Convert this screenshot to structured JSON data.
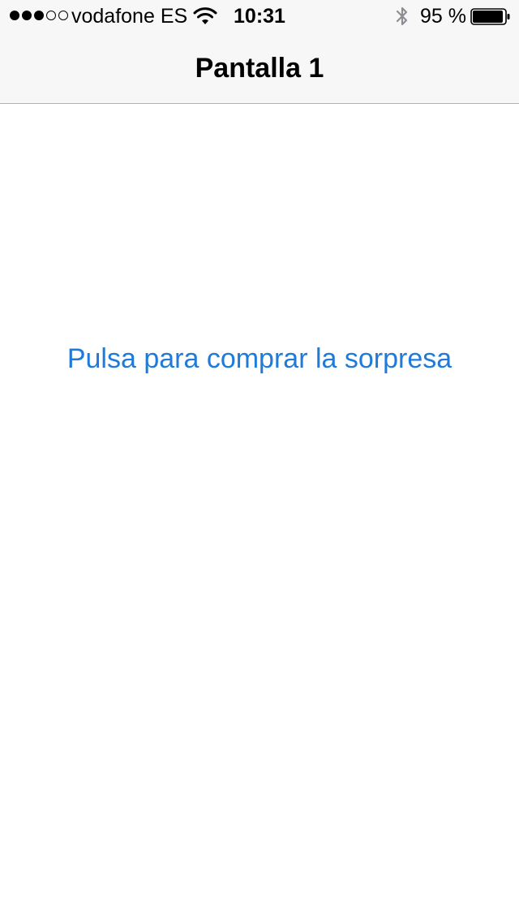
{
  "status_bar": {
    "signal_bars_filled": 3,
    "signal_bars_total": 5,
    "carrier": "vodafone ES",
    "time": "10:31",
    "battery_percent_label": "95 %",
    "battery_level": 0.95,
    "icons": [
      "signal-dots-icon",
      "wifi-icon",
      "bluetooth-icon",
      "battery-icon"
    ]
  },
  "nav_bar": {
    "title": "Pantalla 1"
  },
  "main": {
    "purchase_button_label": "Pulsa para comprar la sorpresa"
  },
  "colors": {
    "tint": "#1f7ad8",
    "bar_background": "#f7f7f7",
    "bar_border": "#b2b2b2"
  }
}
